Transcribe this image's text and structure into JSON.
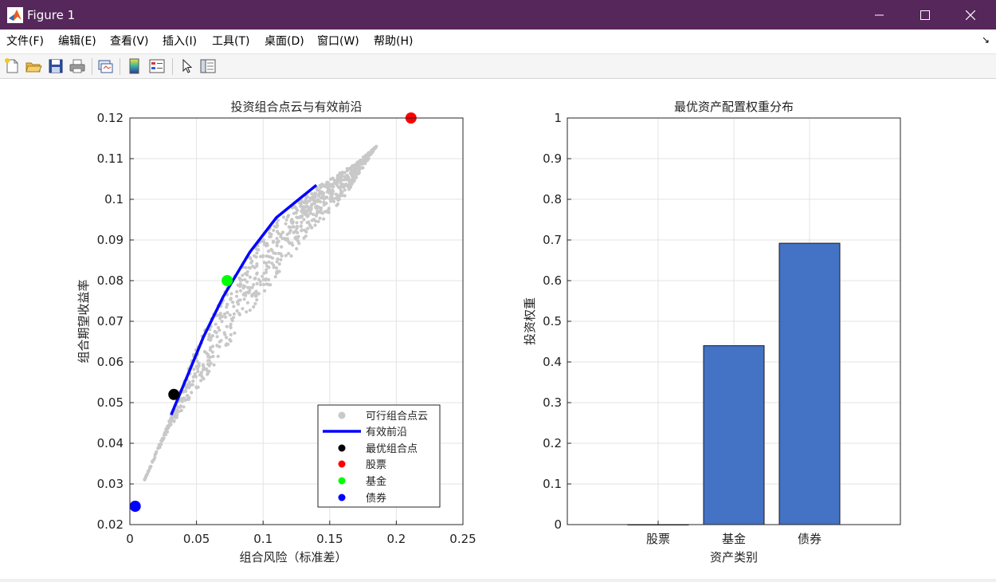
{
  "window": {
    "title": "Figure 1",
    "minimize_label": "—",
    "maximize_label": "☐",
    "close_label": "✕"
  },
  "menu": {
    "items": [
      "文件(F)",
      "编辑(E)",
      "查看(V)",
      "插入(I)",
      "工具(T)",
      "桌面(D)",
      "窗口(W)",
      "帮助(H)"
    ],
    "overflow_icon": "dock-arrow-icon"
  },
  "toolbar": {
    "icons": [
      "new-figure-icon",
      "open-file-icon",
      "save-icon",
      "print-icon",
      "link-figure-icon",
      "colorbar-icon",
      "legend-icon",
      "edit-plot-icon",
      "property-inspector-icon"
    ]
  },
  "chart_data": [
    {
      "type": "scatter",
      "title": "投资组合点云与有效前沿",
      "xlabel": "组合风险（标准差）",
      "ylabel": "组合期望收益率",
      "xlim": [
        0,
        0.25
      ],
      "ylim": [
        0.02,
        0.12
      ],
      "xticks": [
        "0",
        "0.05",
        "0.1",
        "0.15",
        "0.2",
        "0.25"
      ],
      "yticks": [
        "0.02",
        "0.03",
        "0.04",
        "0.05",
        "0.06",
        "0.07",
        "0.08",
        "0.09",
        "0.1",
        "0.11",
        "0.12"
      ],
      "grid": true,
      "legend_position": "bottom-right",
      "cloud": {
        "name": "可行组合点云",
        "color": "#c8c8c8",
        "lower_edge": [
          [
            0.011,
            0.031
          ],
          [
            0.03,
            0.044
          ],
          [
            0.055,
            0.055
          ],
          [
            0.09,
            0.072
          ],
          [
            0.13,
            0.09
          ],
          [
            0.16,
            0.1
          ],
          [
            0.185,
            0.113
          ]
        ],
        "upper_edge": [
          [
            0.011,
            0.031
          ],
          [
            0.03,
            0.046
          ],
          [
            0.05,
            0.064
          ],
          [
            0.08,
            0.083
          ],
          [
            0.11,
            0.095
          ],
          [
            0.14,
            0.103
          ],
          [
            0.17,
            0.109
          ],
          [
            0.185,
            0.113
          ]
        ]
      },
      "series": [
        {
          "name": "有效前沿",
          "type": "line",
          "color": "#0000ff",
          "points": [
            [
              0.031,
              0.047
            ],
            [
              0.045,
              0.058
            ],
            [
              0.055,
              0.066
            ],
            [
              0.07,
              0.076
            ],
            [
              0.09,
              0.087
            ],
            [
              0.11,
              0.0955
            ],
            [
              0.125,
              0.0995
            ],
            [
              0.14,
              0.1035
            ]
          ]
        },
        {
          "name": "最优组合点",
          "type": "point",
          "color": "#000000",
          "points": [
            [
              0.033,
              0.052
            ]
          ]
        },
        {
          "name": "股票",
          "type": "point",
          "color": "#ff0000",
          "points": [
            [
              0.211,
              0.12
            ]
          ]
        },
        {
          "name": "基金",
          "type": "point",
          "color": "#00ff00",
          "points": [
            [
              0.073,
              0.08
            ]
          ]
        },
        {
          "name": "债券",
          "type": "point",
          "color": "#0000ff",
          "points": [
            [
              0.004,
              0.0245
            ]
          ]
        }
      ],
      "legend": [
        "可行组合点云",
        "有效前沿",
        "最优组合点",
        "股票",
        "基金",
        "债券"
      ]
    },
    {
      "type": "bar",
      "title": "最优资产配置权重分布",
      "xlabel": "资产类别",
      "ylabel": "投资权重",
      "ylim": [
        0,
        1
      ],
      "yticks": [
        "0",
        "0.1",
        "0.2",
        "0.3",
        "0.4",
        "0.5",
        "0.6",
        "0.7",
        "0.8",
        "0.9",
        "1"
      ],
      "categories": [
        "股票",
        "基金",
        "债券"
      ],
      "values": [
        0.0,
        0.44,
        0.692
      ],
      "bar_color": "#4472c4",
      "grid": true
    }
  ]
}
